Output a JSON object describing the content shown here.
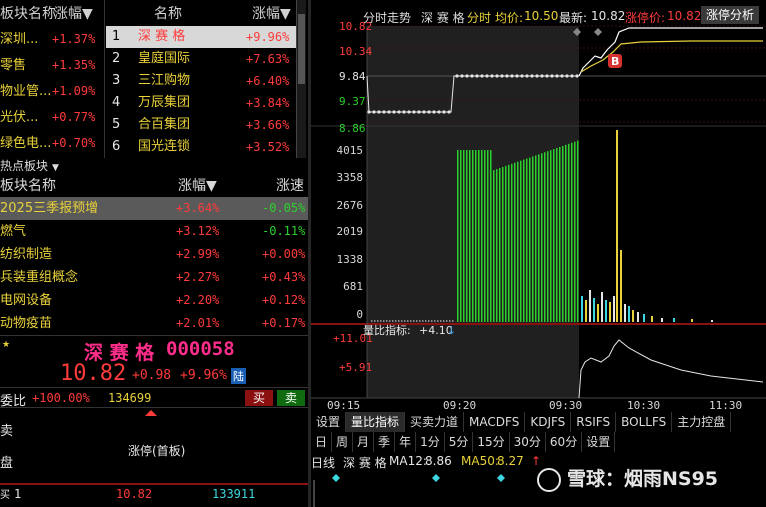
{
  "sector_panel": {
    "header": "板块名称",
    "change_header": "涨幅",
    "rows": [
      {
        "name": "深圳...",
        "change": "+1.37%"
      },
      {
        "name": "零售",
        "change": "+1.35%"
      },
      {
        "name": "物业管...",
        "change": "+1.09%"
      },
      {
        "name": "光伏...",
        "change": "+0.77%"
      },
      {
        "name": "绿色电...",
        "change": "+0.70%"
      }
    ]
  },
  "ranking_panel": {
    "name_header": "名称",
    "change_header": "涨幅",
    "rows": [
      {
        "rank": "1",
        "name": "深 赛 格",
        "change": "+9.96%"
      },
      {
        "rank": "2",
        "name": "皇庭国际",
        "change": "+7.63%"
      },
      {
        "rank": "3",
        "name": "三江购物",
        "change": "+6.40%"
      },
      {
        "rank": "4",
        "name": "万辰集团",
        "change": "+3.84%"
      },
      {
        "rank": "5",
        "name": "合百集团",
        "change": "+3.66%"
      },
      {
        "rank": "6",
        "name": "国光连锁",
        "change": "+3.52%"
      }
    ]
  },
  "hot_sectors": {
    "title": "热点板块",
    "col_name": "板块名称",
    "col_change": "涨幅",
    "col_speed": "涨速",
    "rows": [
      {
        "name": "2025三季报预增",
        "change": "+3.64%",
        "speed": "-0.05%",
        "speed_color": "green"
      },
      {
        "name": "燃气",
        "change": "+3.12%",
        "speed": "-0.11%",
        "speed_color": "green"
      },
      {
        "name": "纺织制造",
        "change": "+2.99%",
        "speed": "+0.00%",
        "speed_color": "red"
      },
      {
        "name": "兵装重组概念",
        "change": "+2.27%",
        "speed": "+0.43%",
        "speed_color": "red"
      },
      {
        "name": "电网设备",
        "change": "+2.20%",
        "speed": "+0.12%",
        "speed_color": "red"
      },
      {
        "name": "动物疫苗",
        "change": "+2.01%",
        "speed": "+0.17%",
        "speed_color": "red"
      }
    ]
  },
  "stock": {
    "name": "深 赛 格",
    "code": "000058",
    "price": "10.82",
    "change": "+0.98",
    "change_pct": "+9.96%",
    "market_tag": "陆",
    "ratio_label": "委比",
    "ratio_value": "+100.00%",
    "ratio_volume": "134699",
    "buy_label": "买",
    "sell_label": "卖",
    "side_labels": [
      "卖",
      "盘"
    ],
    "limit_status": "涨停(首板)",
    "buy_row": {
      "level": "1",
      "price": "10.82",
      "volume": "133911"
    }
  },
  "chart": {
    "title": "分时走势",
    "stock_name": "深 赛 格",
    "mode": "分时",
    "avg_label": "均价:",
    "avg_price": "10.50",
    "latest_label": "最新:",
    "latest_price": "10.82",
    "limit_label": "涨停价:",
    "limit_price": "10.82",
    "analysis_button": "涨停分析",
    "price_axis": [
      "10.82",
      "10.34",
      "9.84",
      "9.37",
      "8.86"
    ],
    "volume_axis": [
      "4015",
      "3358",
      "2676",
      "2019",
      "1338",
      "681",
      "0"
    ],
    "ratio_title": "量比指标:",
    "ratio_value": "+4.10",
    "ratio_axis": [
      "+11.01",
      "+5.91"
    ],
    "time_axis": [
      "09:15",
      "09:20",
      "09:30",
      "10:30",
      "11:30"
    ],
    "marker_label": "B",
    "colors": {
      "price_line": "#ffffff",
      "avg_line": "#e8d13a",
      "up": "#ff3b3b",
      "down": "#2bd12b"
    }
  },
  "tabs_row1": [
    "设置",
    "量比指标",
    "买卖力道",
    "MACDFS",
    "KDJFS",
    "RSIFS",
    "BOLLFS",
    "主力控盘"
  ],
  "tabs_row2": [
    "日",
    "周",
    "月",
    "季",
    "年",
    "1分",
    "5分",
    "15分",
    "30分",
    "60分",
    "设置"
  ],
  "kline": {
    "label": "日线",
    "stock_name": "深 赛 格",
    "ma12_label": "MA12:",
    "ma12_value": "8.86",
    "ma50_label": "MA50:",
    "ma50_value": "8.27"
  },
  "watermark": "雪球：烟雨NS95"
}
